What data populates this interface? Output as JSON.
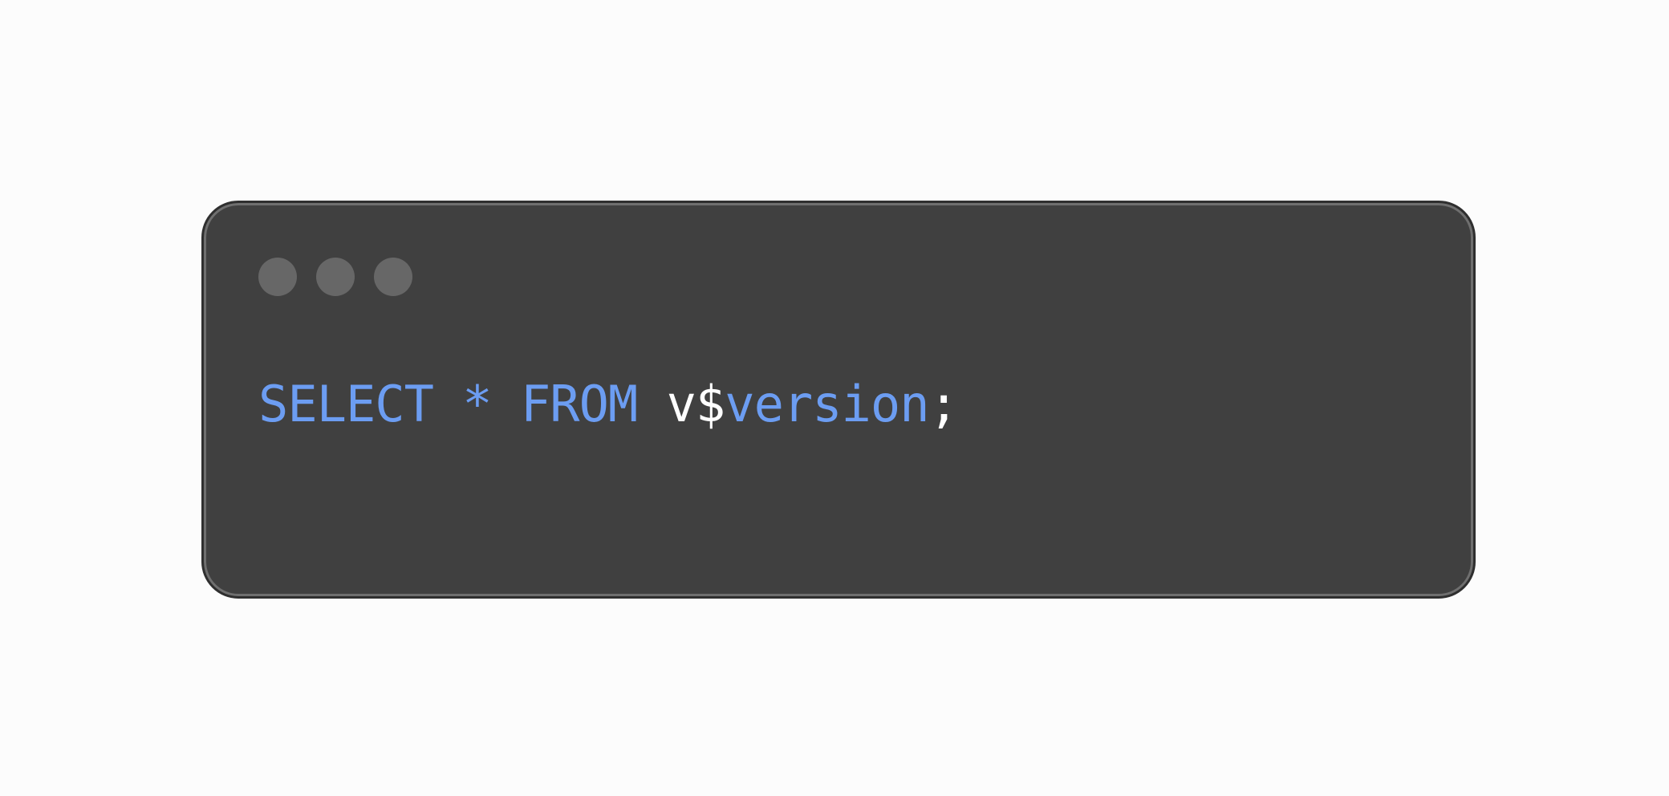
{
  "colors": {
    "background": "#fcfcfc",
    "window_bg": "#404040",
    "window_border": "#2f2f2f",
    "dot": "#676767",
    "keyword": "#6c9df2",
    "text": "#ffffff"
  },
  "window_controls": [
    {
      "name": "window-dot-1"
    },
    {
      "name": "window-dot-2"
    },
    {
      "name": "window-dot-3"
    }
  ],
  "code": {
    "select": "SELECT",
    "star": "*",
    "from": "FROM",
    "ident_prefix": "v$",
    "ident_name": "version",
    "terminator": ";"
  }
}
